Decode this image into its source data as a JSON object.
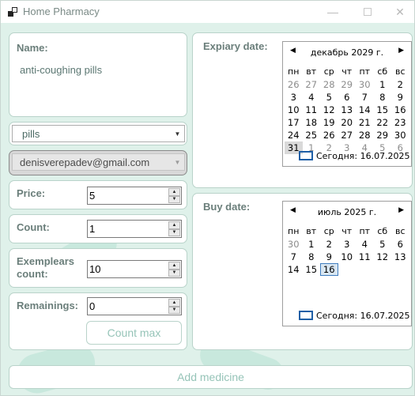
{
  "window": {
    "title": "Home Pharmacy"
  },
  "name": {
    "label": "Name:",
    "value": "anti-coughing pills"
  },
  "type_combo": {
    "value": "pills"
  },
  "email_combo": {
    "value": "denisverepadev@gmail.com"
  },
  "price": {
    "label": "Price:",
    "value": "5"
  },
  "count": {
    "label": "Count:",
    "value": "1"
  },
  "exemplears": {
    "label_line1": "Exemplears",
    "label_line2": "count:",
    "value": "10"
  },
  "remainings": {
    "label": "Remainings:",
    "value": "0",
    "button": "Count max"
  },
  "add_button": "Add medicine",
  "expiry": {
    "label": "Expiary date:",
    "month": "декабрь 2029 г.",
    "weekdays": [
      "пн",
      "вт",
      "ср",
      "чт",
      "пт",
      "сб",
      "вс"
    ],
    "weeks": [
      [
        "26",
        "27",
        "28",
        "29",
        "30",
        "1",
        "2"
      ],
      [
        "3",
        "4",
        "5",
        "6",
        "7",
        "8",
        "9"
      ],
      [
        "10",
        "11",
        "12",
        "13",
        "14",
        "15",
        "16"
      ],
      [
        "17",
        "18",
        "19",
        "20",
        "21",
        "22",
        "23"
      ],
      [
        "24",
        "25",
        "26",
        "27",
        "28",
        "29",
        "30"
      ],
      [
        "31",
        "1",
        "2",
        "3",
        "4",
        "5",
        "6"
      ]
    ],
    "today": "Сегодня: 16.07.2025"
  },
  "buy": {
    "label": "Buy date:",
    "month": "июль 2025 г.",
    "weekdays": [
      "пн",
      "вт",
      "ср",
      "чт",
      "пт",
      "сб",
      "вс"
    ],
    "weeks": [
      [
        "30",
        "1",
        "2",
        "3",
        "4",
        "5",
        "6"
      ],
      [
        "7",
        "8",
        "9",
        "10",
        "11",
        "12",
        "13"
      ],
      [
        "14",
        "15",
        "16",
        "",
        "",
        "",
        ""
      ]
    ],
    "today": "Сегодня: 16.07.2025"
  },
  "colors": {
    "background": "#dff1ea",
    "panel_border": "#b9d3ca",
    "label": "#6a7e7a",
    "button_text": "#96c4b8"
  }
}
